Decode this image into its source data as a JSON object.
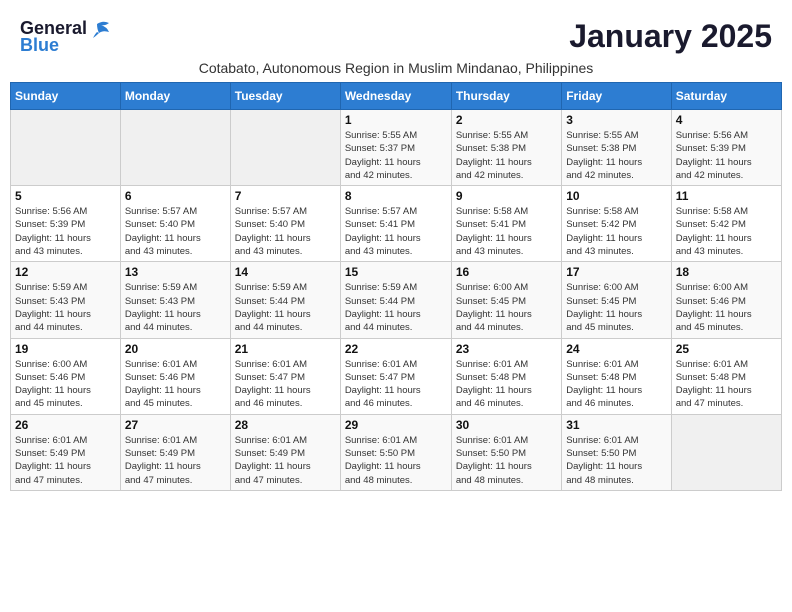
{
  "header": {
    "logo_general": "General",
    "logo_blue": "Blue",
    "month_title": "January 2025",
    "subtitle": "Cotabato, Autonomous Region in Muslim Mindanao, Philippines"
  },
  "weekdays": [
    "Sunday",
    "Monday",
    "Tuesday",
    "Wednesday",
    "Thursday",
    "Friday",
    "Saturday"
  ],
  "weeks": [
    [
      {
        "day": "",
        "info": ""
      },
      {
        "day": "",
        "info": ""
      },
      {
        "day": "",
        "info": ""
      },
      {
        "day": "1",
        "info": "Sunrise: 5:55 AM\nSunset: 5:37 PM\nDaylight: 11 hours\nand 42 minutes."
      },
      {
        "day": "2",
        "info": "Sunrise: 5:55 AM\nSunset: 5:38 PM\nDaylight: 11 hours\nand 42 minutes."
      },
      {
        "day": "3",
        "info": "Sunrise: 5:55 AM\nSunset: 5:38 PM\nDaylight: 11 hours\nand 42 minutes."
      },
      {
        "day": "4",
        "info": "Sunrise: 5:56 AM\nSunset: 5:39 PM\nDaylight: 11 hours\nand 42 minutes."
      }
    ],
    [
      {
        "day": "5",
        "info": "Sunrise: 5:56 AM\nSunset: 5:39 PM\nDaylight: 11 hours\nand 43 minutes."
      },
      {
        "day": "6",
        "info": "Sunrise: 5:57 AM\nSunset: 5:40 PM\nDaylight: 11 hours\nand 43 minutes."
      },
      {
        "day": "7",
        "info": "Sunrise: 5:57 AM\nSunset: 5:40 PM\nDaylight: 11 hours\nand 43 minutes."
      },
      {
        "day": "8",
        "info": "Sunrise: 5:57 AM\nSunset: 5:41 PM\nDaylight: 11 hours\nand 43 minutes."
      },
      {
        "day": "9",
        "info": "Sunrise: 5:58 AM\nSunset: 5:41 PM\nDaylight: 11 hours\nand 43 minutes."
      },
      {
        "day": "10",
        "info": "Sunrise: 5:58 AM\nSunset: 5:42 PM\nDaylight: 11 hours\nand 43 minutes."
      },
      {
        "day": "11",
        "info": "Sunrise: 5:58 AM\nSunset: 5:42 PM\nDaylight: 11 hours\nand 43 minutes."
      }
    ],
    [
      {
        "day": "12",
        "info": "Sunrise: 5:59 AM\nSunset: 5:43 PM\nDaylight: 11 hours\nand 44 minutes."
      },
      {
        "day": "13",
        "info": "Sunrise: 5:59 AM\nSunset: 5:43 PM\nDaylight: 11 hours\nand 44 minutes."
      },
      {
        "day": "14",
        "info": "Sunrise: 5:59 AM\nSunset: 5:44 PM\nDaylight: 11 hours\nand 44 minutes."
      },
      {
        "day": "15",
        "info": "Sunrise: 5:59 AM\nSunset: 5:44 PM\nDaylight: 11 hours\nand 44 minutes."
      },
      {
        "day": "16",
        "info": "Sunrise: 6:00 AM\nSunset: 5:45 PM\nDaylight: 11 hours\nand 44 minutes."
      },
      {
        "day": "17",
        "info": "Sunrise: 6:00 AM\nSunset: 5:45 PM\nDaylight: 11 hours\nand 45 minutes."
      },
      {
        "day": "18",
        "info": "Sunrise: 6:00 AM\nSunset: 5:46 PM\nDaylight: 11 hours\nand 45 minutes."
      }
    ],
    [
      {
        "day": "19",
        "info": "Sunrise: 6:00 AM\nSunset: 5:46 PM\nDaylight: 11 hours\nand 45 minutes."
      },
      {
        "day": "20",
        "info": "Sunrise: 6:01 AM\nSunset: 5:46 PM\nDaylight: 11 hours\nand 45 minutes."
      },
      {
        "day": "21",
        "info": "Sunrise: 6:01 AM\nSunset: 5:47 PM\nDaylight: 11 hours\nand 46 minutes."
      },
      {
        "day": "22",
        "info": "Sunrise: 6:01 AM\nSunset: 5:47 PM\nDaylight: 11 hours\nand 46 minutes."
      },
      {
        "day": "23",
        "info": "Sunrise: 6:01 AM\nSunset: 5:48 PM\nDaylight: 11 hours\nand 46 minutes."
      },
      {
        "day": "24",
        "info": "Sunrise: 6:01 AM\nSunset: 5:48 PM\nDaylight: 11 hours\nand 46 minutes."
      },
      {
        "day": "25",
        "info": "Sunrise: 6:01 AM\nSunset: 5:48 PM\nDaylight: 11 hours\nand 47 minutes."
      }
    ],
    [
      {
        "day": "26",
        "info": "Sunrise: 6:01 AM\nSunset: 5:49 PM\nDaylight: 11 hours\nand 47 minutes."
      },
      {
        "day": "27",
        "info": "Sunrise: 6:01 AM\nSunset: 5:49 PM\nDaylight: 11 hours\nand 47 minutes."
      },
      {
        "day": "28",
        "info": "Sunrise: 6:01 AM\nSunset: 5:49 PM\nDaylight: 11 hours\nand 47 minutes."
      },
      {
        "day": "29",
        "info": "Sunrise: 6:01 AM\nSunset: 5:50 PM\nDaylight: 11 hours\nand 48 minutes."
      },
      {
        "day": "30",
        "info": "Sunrise: 6:01 AM\nSunset: 5:50 PM\nDaylight: 11 hours\nand 48 minutes."
      },
      {
        "day": "31",
        "info": "Sunrise: 6:01 AM\nSunset: 5:50 PM\nDaylight: 11 hours\nand 48 minutes."
      },
      {
        "day": "",
        "info": ""
      }
    ]
  ]
}
